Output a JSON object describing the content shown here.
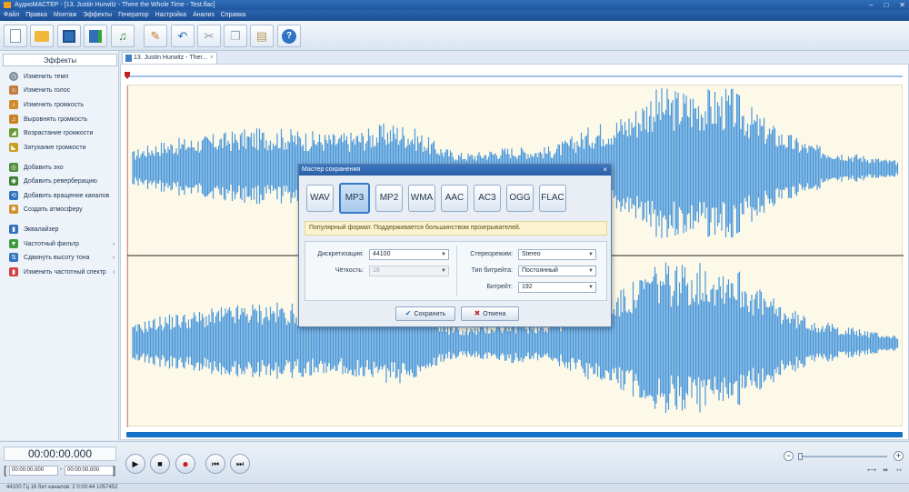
{
  "titlebar": {
    "title": "АудиоМАСТЕР - [13. Justin Hurwitz - There the Whole Time - Test.flac]"
  },
  "menu": [
    "Файл",
    "Правка",
    "Монтаж",
    "Эффекты",
    "Генератор",
    "Настройка",
    "Анализ",
    "Справка"
  ],
  "sidebar": {
    "header": "Эффекты",
    "items": [
      {
        "label": "Изменить темп",
        "icon": "tempo-icon",
        "color": "#7a8a9c"
      },
      {
        "label": "Изменить голос",
        "icon": "voice-icon",
        "color": "#c47a3a"
      },
      {
        "label": "Изменить громкость",
        "icon": "volume-icon",
        "color": "#d08a2c"
      },
      {
        "label": "Выровнять громкость",
        "icon": "normalize-icon",
        "color": "#c9801f"
      },
      {
        "label": "Возрастание громкости",
        "icon": "fade-in-icon",
        "color": "#6a9a30"
      },
      {
        "label": "Затухание громкости",
        "icon": "fade-out-icon",
        "color": "#c8a020"
      },
      {
        "label": "Добавить эхо",
        "icon": "echo-icon",
        "color": "#4f8c3a"
      },
      {
        "label": "Добавить реверберацию",
        "icon": "reverb-icon",
        "color": "#3b7f2e"
      },
      {
        "label": "Добавить вращение каналов",
        "icon": "rotate-icon",
        "color": "#2f74c0"
      },
      {
        "label": "Создать атмосферу",
        "icon": "atmosphere-icon",
        "color": "#d0902a"
      },
      {
        "label": "Эквалайзер",
        "icon": "equalizer-icon",
        "color": "#2e70bd"
      },
      {
        "label": "Частотный фильтр",
        "icon": "filter-icon",
        "color": "#3b9b3b"
      },
      {
        "label": "Сдвинуть высоту тона",
        "icon": "pitch-icon",
        "color": "#3277c2"
      },
      {
        "label": "Изменить частотный спектр",
        "icon": "spectrum-icon",
        "color": "#d24040"
      }
    ]
  },
  "tab": {
    "label": "13. Justin Hurwitz - Ther...",
    "close": "×"
  },
  "dialog": {
    "title": "Мастер сохранения",
    "close": "×",
    "formats": [
      "WAV",
      "MP3",
      "MP2",
      "WMA",
      "AAC",
      "AC3",
      "OGG",
      "FLAC"
    ],
    "selected_format": "MP3",
    "description": "Популярный формат. Поддерживается большинством проигрывателей.",
    "fields": {
      "sample_rate_label": "Дискретизация:",
      "sample_rate_value": "44100",
      "bit_depth_label": "Чёткость:",
      "bit_depth_value": "16",
      "stereo_label": "Стереорежим:",
      "stereo_value": "Stereo",
      "bitrate_type_label": "Тип битрейта:",
      "bitrate_type_value": "Постоянный",
      "bitrate_label": "Битрейт:",
      "bitrate_value": "192"
    },
    "save_button": "Сохранить",
    "cancel_button": "Отмена"
  },
  "transport": {
    "time_main": "00:00:00.000",
    "time_start": "00:00:00.000",
    "time_end": "00:00:00.000",
    "separator": "-"
  },
  "status": {
    "text": "44100 Гц   16 бит   каналов: 2   0:00:44 1057452"
  },
  "colors": {
    "waveform": "#4a98dc",
    "accent": "#1473c6",
    "playhead": "#c02020"
  }
}
